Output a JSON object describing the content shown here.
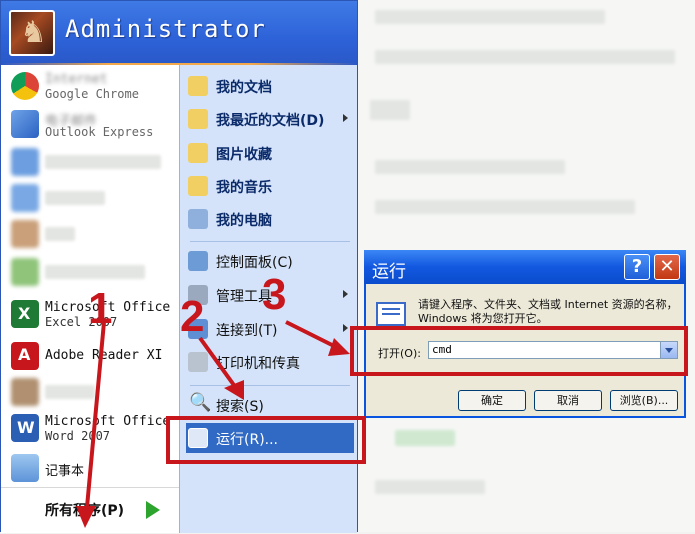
{
  "start_menu": {
    "username": "Administrator",
    "pinned": [
      {
        "title": "Internet",
        "subtitle": "Google Chrome",
        "icon": "chrome-icon",
        "blurred_title": true
      },
      {
        "title": "电子邮件",
        "subtitle": "Outlook Express",
        "icon": "outlook-express-icon",
        "blurred_title": true
      }
    ],
    "recent": [
      {
        "label": "",
        "icon": "blurred-app-icon"
      },
      {
        "label": "",
        "icon": "blurred-app-icon"
      },
      {
        "label": "",
        "icon": "blurred-app-icon"
      },
      {
        "label": "",
        "icon": "blurred-app-icon"
      },
      {
        "title": "Microsoft Office",
        "subtitle": "Excel 2007",
        "icon": "excel-icon"
      },
      {
        "label": "Adobe Reader XI",
        "icon": "adobe-reader-icon"
      },
      {
        "label": "",
        "icon": "blurred-app-icon"
      },
      {
        "title": "Microsoft Office",
        "subtitle": "Word 2007",
        "icon": "word-icon"
      },
      {
        "label": "记事本",
        "icon": "notepad-icon"
      }
    ],
    "all_programs": "所有程序(P)",
    "places": [
      {
        "label": "我的文档",
        "icon": "my-documents-icon",
        "bold": true
      },
      {
        "label": "我最近的文档(D)",
        "icon": "recent-documents-icon",
        "bold": true,
        "submenu": true
      },
      {
        "label": "图片收藏",
        "icon": "my-pictures-icon",
        "bold": true
      },
      {
        "label": "我的音乐",
        "icon": "my-music-icon",
        "bold": true
      },
      {
        "label": "我的电脑",
        "icon": "my-computer-icon",
        "bold": true
      },
      {
        "label": "控制面板(C)",
        "icon": "control-panel-icon",
        "bold": false
      },
      {
        "label": "管理工具",
        "icon": "admin-tools-icon",
        "bold": false,
        "submenu": true
      },
      {
        "label": "连接到(T)",
        "icon": "connect-to-icon",
        "bold": false,
        "submenu": true
      },
      {
        "label": "打印机和传真",
        "icon": "printers-icon",
        "bold": false
      },
      {
        "label": "搜索(S)",
        "icon": "search-icon",
        "bold": false
      },
      {
        "label": "运行(R)...",
        "icon": "run-icon",
        "bold": false,
        "highlighted": true
      }
    ]
  },
  "run_dialog": {
    "title": "运行",
    "description": "请键入程序、文件夹、文档或 Internet 资源的名称，Windows 将为您打开它。",
    "open_label": "打开(O):",
    "open_value": "cmd",
    "ok": "确定",
    "cancel": "取消",
    "browse": "浏览(B)..."
  },
  "annotations": {
    "step1": "1",
    "step2": "2",
    "step3": "3",
    "color": "#c8161d"
  }
}
